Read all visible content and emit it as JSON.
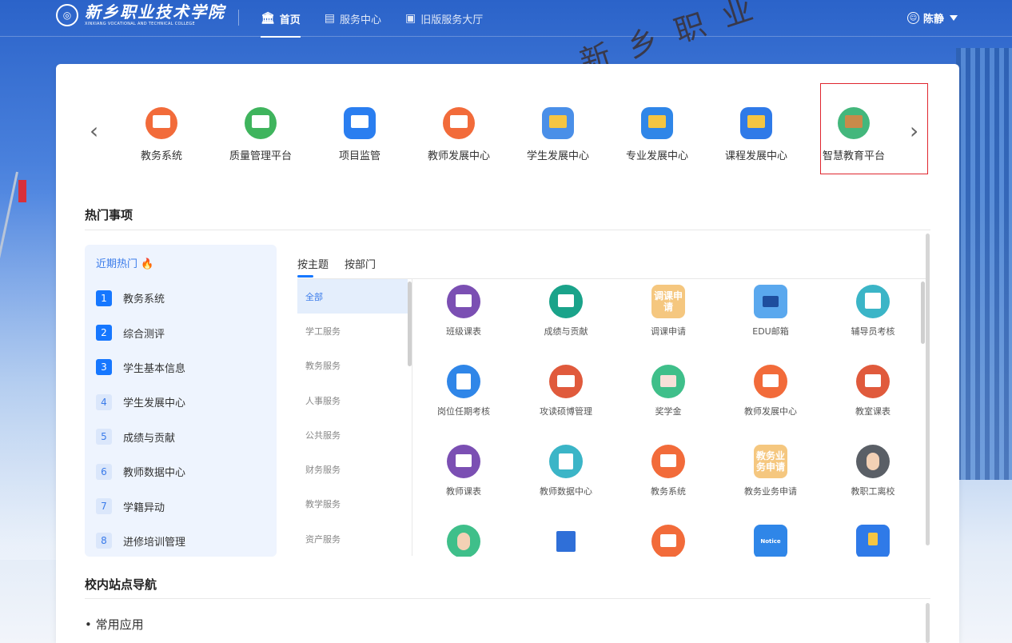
{
  "header": {
    "logo_main": "新乡职业技术学院",
    "logo_sub": "XINXIANG VOCATIONAL AND TECHNICAL COLLEGE",
    "nav": [
      {
        "label": "首页",
        "icon": "bank-icon",
        "active": true
      },
      {
        "label": "服务中心",
        "icon": "service-icon",
        "active": false
      },
      {
        "label": "旧版服务大厅",
        "icon": "document-icon",
        "active": false
      }
    ],
    "user_name": "陈静"
  },
  "carousel": {
    "apps": [
      {
        "label": "教务系统",
        "icon": "presentation-board-icon",
        "color": "#f26b3a"
      },
      {
        "label": "质量管理平台",
        "icon": "dashboard-icon",
        "color": "#3fb45d"
      },
      {
        "label": "项目监管",
        "icon": "monitor-icon",
        "color": "#2a7ef0"
      },
      {
        "label": "教师发展中心",
        "icon": "presentation-board-icon",
        "color": "#f26b3a"
      },
      {
        "label": "学生发展中心",
        "icon": "student-growth-icon",
        "color": "#4a8fe8"
      },
      {
        "label": "专业发展中心",
        "icon": "folder-settings-icon",
        "color": "#2f86e8"
      },
      {
        "label": "课程发展中心",
        "icon": "course-growth-icon",
        "color": "#2f7ae8"
      },
      {
        "label": "智慧教育平台",
        "icon": "teacher-avatar-icon",
        "color": "#43b77c"
      }
    ]
  },
  "hot": {
    "title": "热门事项",
    "panel_title": "近期热门",
    "items": [
      {
        "rank": "1",
        "label": "教务系统"
      },
      {
        "rank": "2",
        "label": "综合测评"
      },
      {
        "rank": "3",
        "label": "学生基本信息"
      },
      {
        "rank": "4",
        "label": "学生发展中心"
      },
      {
        "rank": "5",
        "label": "成绩与贡献"
      },
      {
        "rank": "6",
        "label": "教师数据中心"
      },
      {
        "rank": "7",
        "label": "学籍异动"
      },
      {
        "rank": "8",
        "label": "进修培训管理"
      }
    ],
    "tabs": [
      {
        "label": "按主题",
        "active": true
      },
      {
        "label": "按部门",
        "active": false
      }
    ],
    "categories": [
      {
        "label": "全部",
        "active": true
      },
      {
        "label": "学工服务",
        "active": false
      },
      {
        "label": "教务服务",
        "active": false
      },
      {
        "label": "人事服务",
        "active": false
      },
      {
        "label": "公共服务",
        "active": false
      },
      {
        "label": "财务服务",
        "active": false
      },
      {
        "label": "教学服务",
        "active": false
      },
      {
        "label": "资产服务",
        "active": false
      }
    ],
    "services": [
      {
        "label": "班级课表",
        "icon": "printer-icon",
        "color": "#7b4fb3"
      },
      {
        "label": "成绩与贡献",
        "icon": "scoreboard-icon",
        "color": "#1aa38a"
      },
      {
        "label": "调课申请",
        "icon": "text-icon",
        "color": "#f5c77f",
        "text": "调课申请"
      },
      {
        "label": "EDU邮箱",
        "icon": "mail-icon",
        "color": "#2f86e8"
      },
      {
        "label": "辅导员考核",
        "icon": "assessment-icon",
        "color": "#3bb5c7"
      },
      {
        "label": "岗位任期考核",
        "icon": "edit-doc-icon",
        "color": "#2f86e8"
      },
      {
        "label": "攻读硕博管理",
        "icon": "book-icon",
        "color": "#e05a3c"
      },
      {
        "label": "奖学金",
        "icon": "envelope-icon",
        "color": "#3fbf8a"
      },
      {
        "label": "教师发展中心",
        "icon": "presentation-board-icon",
        "color": "#f26b3a"
      },
      {
        "label": "教室课表",
        "icon": "search-board-icon",
        "color": "#e05a3c"
      },
      {
        "label": "教师课表",
        "icon": "calendar-icon",
        "color": "#7b4fb3"
      },
      {
        "label": "教师数据中心",
        "icon": "id-card-icon",
        "color": "#3bb5c7"
      },
      {
        "label": "教务系统",
        "icon": "presentation-board-icon",
        "color": "#f26b3a"
      },
      {
        "label": "教务业务申请",
        "icon": "text-icon",
        "color": "#f5c77f",
        "text": "教务业务申请"
      },
      {
        "label": "教职工离校",
        "icon": "person-exit-icon",
        "color": "#5a5f66"
      },
      {
        "label": "",
        "icon": "person-icon",
        "color": "#3fbf8a"
      },
      {
        "label": "",
        "icon": "bank-icon",
        "color": "#2f6fd8"
      },
      {
        "label": "",
        "icon": "presentation-board-icon",
        "color": "#f26b3a"
      },
      {
        "label": "",
        "icon": "notice-icon",
        "color": "#2f86e8",
        "text": "Notice"
      },
      {
        "label": "",
        "icon": "course-growth-icon",
        "color": "#2f7ae8"
      }
    ]
  },
  "nav_section": {
    "title": "校内站点导航",
    "common_label": "• 常用应用"
  }
}
